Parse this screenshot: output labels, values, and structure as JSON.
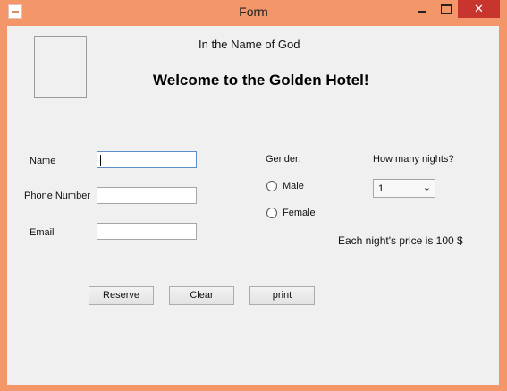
{
  "window": {
    "title": "Form"
  },
  "header": {
    "subtitle": "In the Name of God",
    "headline": "Welcome to the Golden Hotel!"
  },
  "form": {
    "name_label": "Name",
    "name_value": "",
    "phone_label": "Phone Number",
    "phone_value": "",
    "email_label": "Email",
    "email_value": ""
  },
  "gender": {
    "label": "Gender:",
    "options": [
      "Male",
      "Female"
    ]
  },
  "nights": {
    "label": "How many nights?",
    "selected": "1"
  },
  "price_text": "Each night's price is 100 $",
  "buttons": {
    "reserve": "Reserve",
    "clear": "Clear",
    "print": "print"
  },
  "colors": {
    "frame": "#f3976b",
    "client": "#f0f0f0",
    "close": "#c7352e"
  }
}
